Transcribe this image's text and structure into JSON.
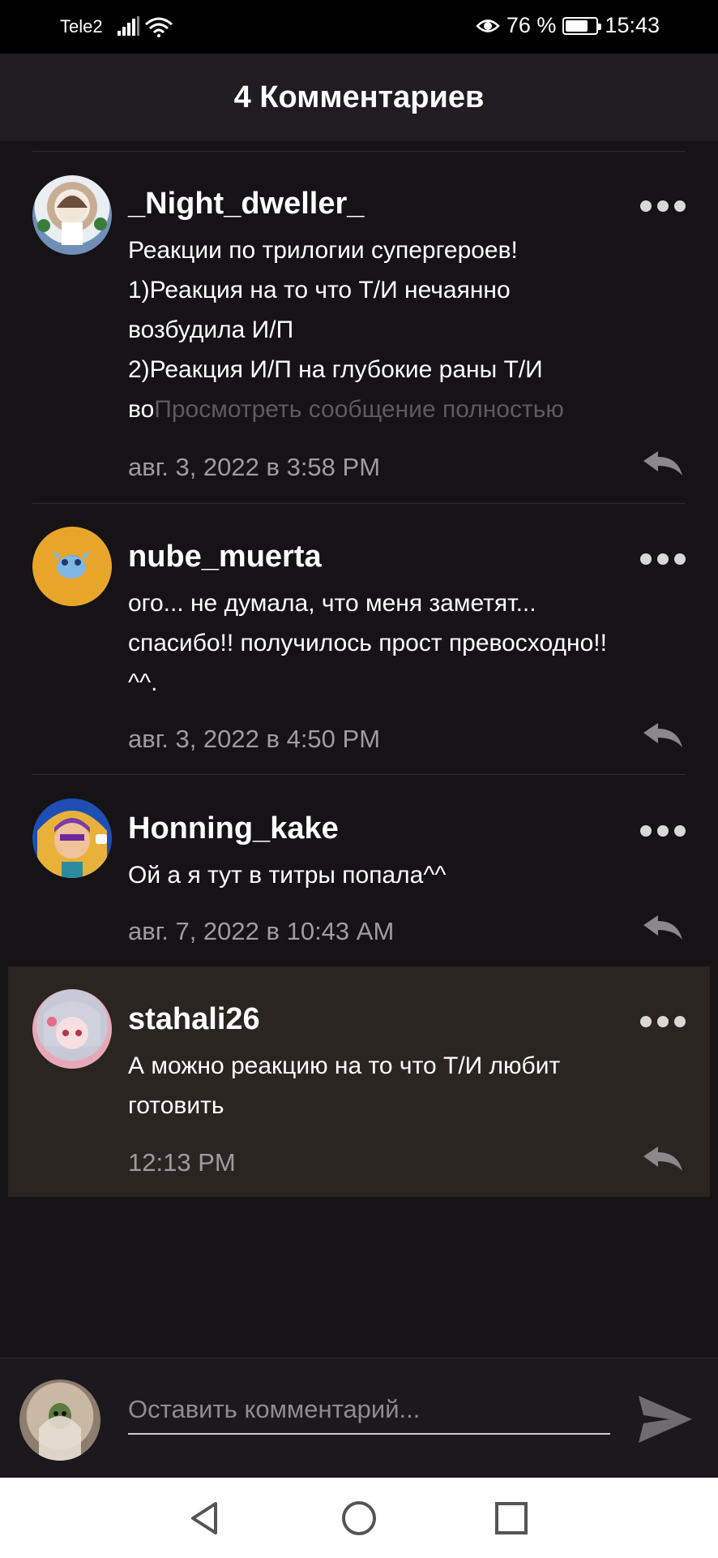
{
  "status_bar": {
    "carrier": "Tele2",
    "battery_percent": "76 %",
    "battery_level": 0.76,
    "time": "15:43"
  },
  "header": {
    "title": "4 Комментариев"
  },
  "comments": [
    {
      "username": "_Night_dweller_",
      "text_lines": [
        "Реакции по трилогии супергероев!",
        "1)Реакция на то что Т/И нечаянно",
        "возбудила И/П",
        "2)Реакция И/П на глубокие раны Т/И"
      ],
      "truncated_prefix": "во",
      "read_more": "Просмотреть сообщение полностью",
      "timestamp": "авг. 3, 2022 в 3:58 PM"
    },
    {
      "username": "nube_muerta",
      "text_lines": [
        "ого... не думала, что меня заметят...",
        "спасибо!! получилось прост превосходно!!",
        "^^."
      ],
      "timestamp": "авг. 3, 2022 в 4:50 PM"
    },
    {
      "username": "Honning_kake",
      "text_lines": [
        "Ой а я тут в титры попала^^"
      ],
      "timestamp": "авг. 7, 2022 в 10:43 AM"
    },
    {
      "username": "stahali26",
      "text_lines": [
        "А можно реакцию на то что Т/И любит",
        "готовить"
      ],
      "timestamp": "12:13 PM"
    }
  ],
  "composer": {
    "placeholder": "Оставить комментарий..."
  },
  "icons": {
    "more": "more-dots-icon",
    "reply": "reply-arrow-icon",
    "send": "send-icon",
    "back": "nav-back-icon",
    "home": "nav-home-icon",
    "recents": "nav-recents-icon"
  }
}
